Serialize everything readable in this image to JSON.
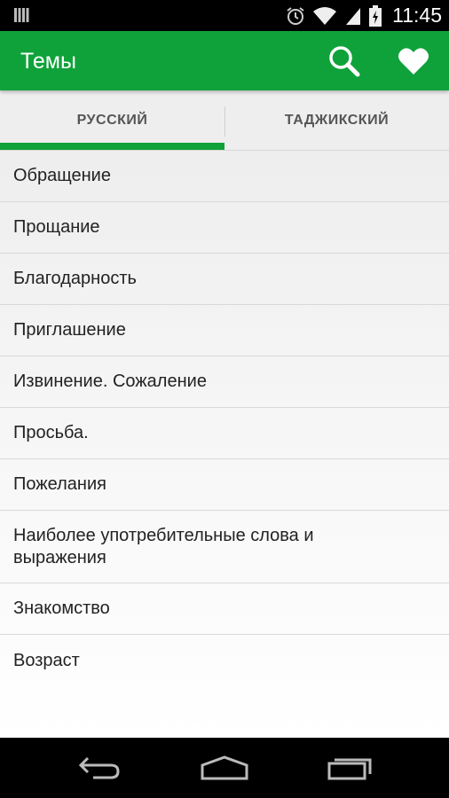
{
  "status_bar": {
    "time": "11:45",
    "icons": [
      "sim-icon",
      "alarm-icon",
      "wifi-icon",
      "signal-icon",
      "battery-charging-icon"
    ]
  },
  "app_bar": {
    "title": "Темы",
    "actions": [
      "search-icon",
      "heart-icon"
    ],
    "color": "#10a23a"
  },
  "tabs": [
    {
      "label": "РУССКИЙ",
      "active": true
    },
    {
      "label": "ТАДЖИКСКИЙ",
      "active": false
    }
  ],
  "topics": [
    "Обращение",
    "Прощание",
    "Благодарность",
    "Приглашение",
    "Извинение. Сожаление",
    "Просьба.",
    "Пожелания",
    "Наиболее употребительные слова и выражения",
    "Знакомство",
    "Возраст"
  ],
  "nav_bar": {
    "buttons": [
      "back-icon",
      "home-icon",
      "recents-icon"
    ]
  }
}
